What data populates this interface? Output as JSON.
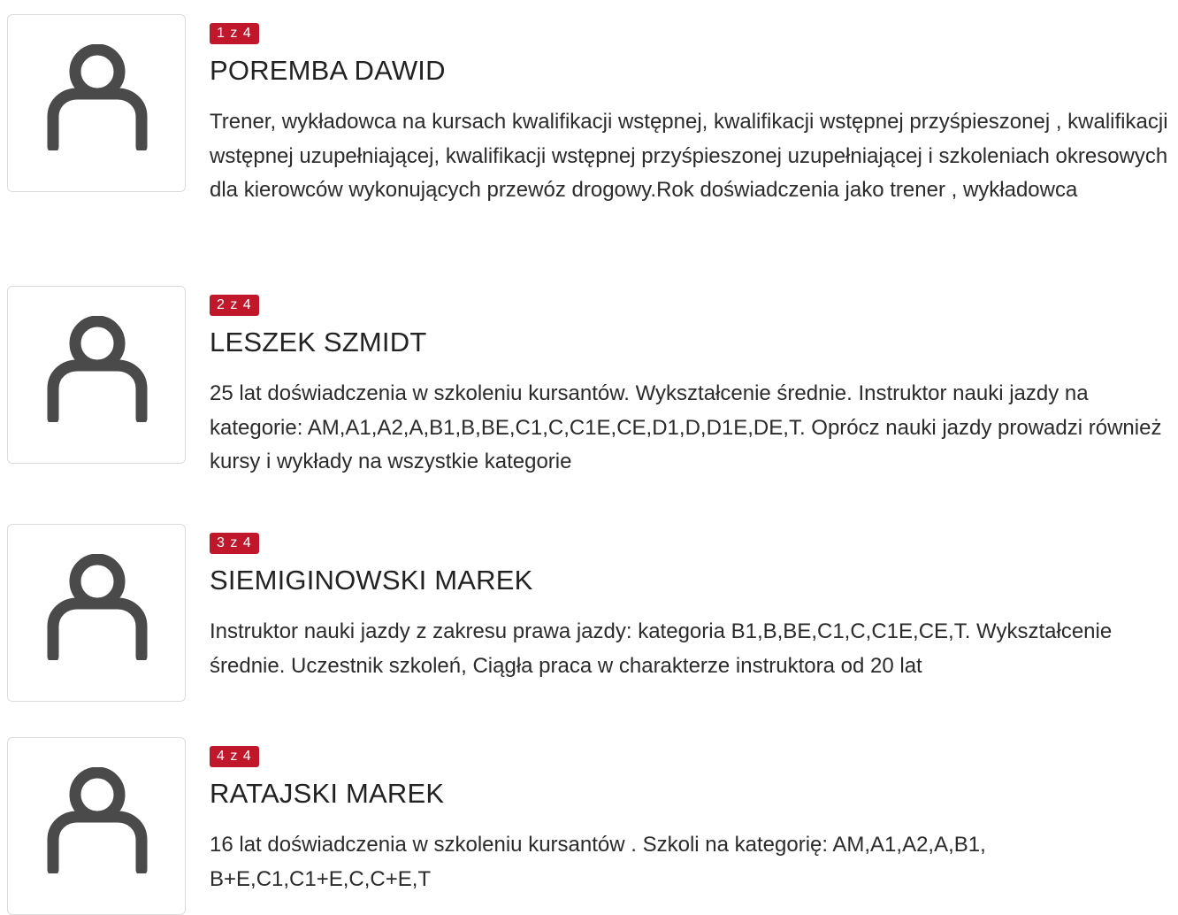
{
  "instructors": [
    {
      "counter": "1 z 4",
      "name": "POREMBA DAWID",
      "bio": "Trener, wykładowca na kursach kwalifikacji wstępnej, kwalifikacji wstępnej przyśpieszonej , kwalifikacji wstępnej uzupełniającej, kwalifikacji wstępnej przyśpieszonej uzupełniającej i szkoleniach okresowych dla kierowców wykonujących przewóz drogowy.Rok doświadczenia jako trener , wykładowca",
      "avatar_icon": "user-icon"
    },
    {
      "counter": "2 z 4",
      "name": "LESZEK SZMIDT",
      "bio": "25 lat doświadczenia w szkoleniu kursantów. Wykształcenie średnie. Instruktor nauki jazdy na kategorie: AM,A1,A2,A,B1,B,BE,C1,C,C1E,CE,D1,D,D1E,DE,T. Oprócz nauki jazdy prowadzi również kursy i wykłady na wszystkie kategorie",
      "avatar_icon": "user-icon"
    },
    {
      "counter": "3 z 4",
      "name": "SIEMIGINOWSKI MAREK",
      "bio": "Instruktor nauki jazdy z zakresu prawa jazdy: kategoria B1,B,BE,C1,C,C1E,CE,T. Wykształcenie średnie. Uczestnik szkoleń, Ciągła praca w charakterze instruktora od 20 lat",
      "avatar_icon": "user-icon"
    },
    {
      "counter": "4 z 4",
      "name": "RATAJSKI MAREK",
      "bio": "16 lat doświadczenia w szkoleniu kursantów . Szkoli na kategorię: AM,A1,A2,A,B1, B+E,C1,C1+E,C,C+E,T",
      "avatar_icon": "user-icon"
    }
  ],
  "colors": {
    "badge": "#c0172b",
    "icon": "#4a4a4a",
    "text": "#222222"
  }
}
